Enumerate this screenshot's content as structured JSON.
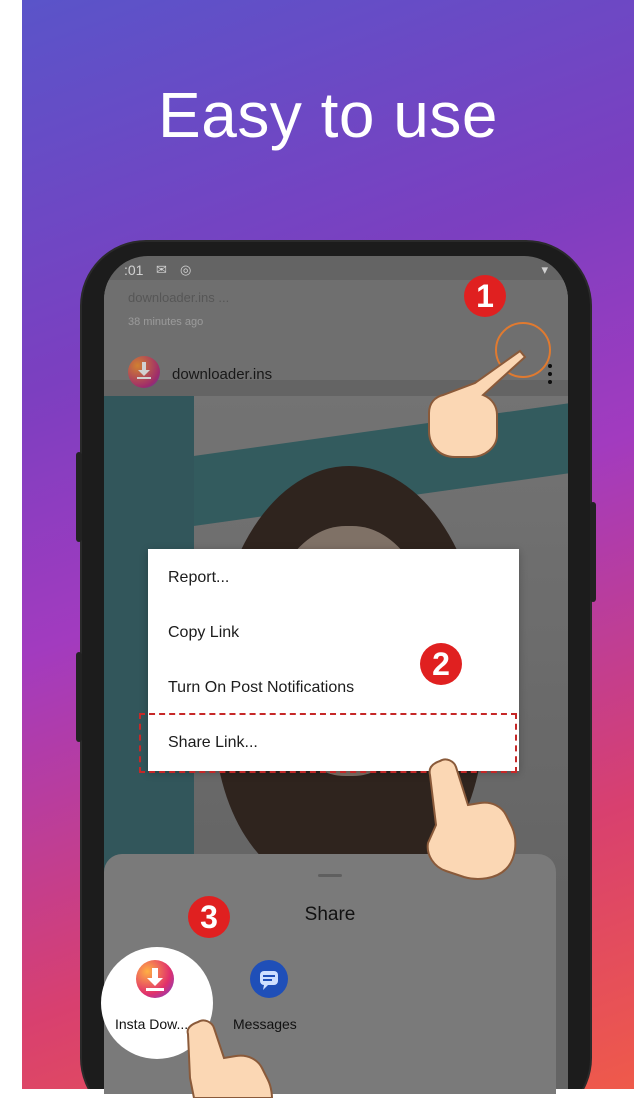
{
  "headline": "Easy to use",
  "status_bar": {
    "time": ":01"
  },
  "post": {
    "snippet": "downloader.ins ...",
    "time_ago": "38 minutes ago",
    "username": "downloader.ins"
  },
  "menu": {
    "items": [
      "Report...",
      "Copy Link",
      "Turn On Post Notifications",
      "Share Link..."
    ]
  },
  "share_sheet": {
    "title": "Share",
    "apps": [
      {
        "label": "Insta Dow...",
        "icon": "insta-download-icon"
      },
      {
        "label": "Messages",
        "icon": "messages-icon"
      }
    ]
  },
  "steps": [
    "1",
    "2",
    "3"
  ],
  "colors": {
    "gradient_start": "#5a54c9",
    "gradient_end": "#ef5a4a",
    "marker_red": "#e02020"
  }
}
